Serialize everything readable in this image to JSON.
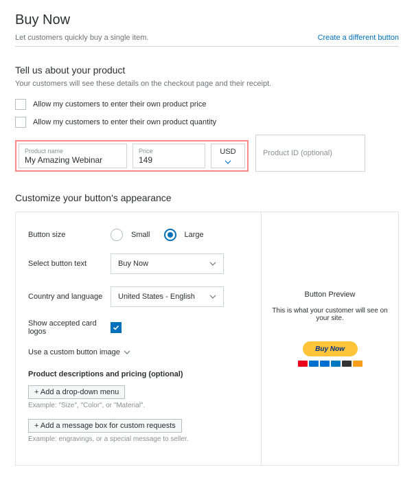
{
  "header": {
    "title": "Buy Now",
    "subtext": "Let customers quickly buy a single item.",
    "link": "Create a different button"
  },
  "product": {
    "section_title": "Tell us about your product",
    "section_sub": "Your customers will see these details on the checkout page and their receipt.",
    "cb_price": "Allow my customers to enter their own product price",
    "cb_qty": "Allow my customers to enter their own product quantity",
    "name_label": "Product name",
    "name_value": "My Amazing Webinar",
    "price_label": "Price",
    "price_value": "149",
    "currency": "USD",
    "pid_placeholder": "Product ID (optional)"
  },
  "customize": {
    "title": "Customize your button's appearance",
    "size_label": "Button size",
    "size_small": "Small",
    "size_large": "Large",
    "text_label": "Select button text",
    "text_value": "Buy Now",
    "country_label": "Country and language",
    "country_value": "United States - English",
    "logos_label": "Show accepted card logos",
    "custom_img_label": "Use a custom button image",
    "options_heading": "Product descriptions and pricing (optional)",
    "add_dropdown": "+ Add a drop-down menu",
    "ex_dropdown": "Example: \"Size\", \"Color\", or \"Material\".",
    "add_msgbox": "+ Add a message box for custom requests",
    "ex_msgbox": "Example: engravings, or a special message to seller."
  },
  "preview": {
    "title": "Button Preview",
    "text": "This is what your customer will see on your site.",
    "btn": "Buy Now",
    "cards": [
      "#eb001b",
      "#0071ce",
      "#006fcf",
      "#0079c1",
      "#333333",
      "#f79e1b"
    ]
  }
}
